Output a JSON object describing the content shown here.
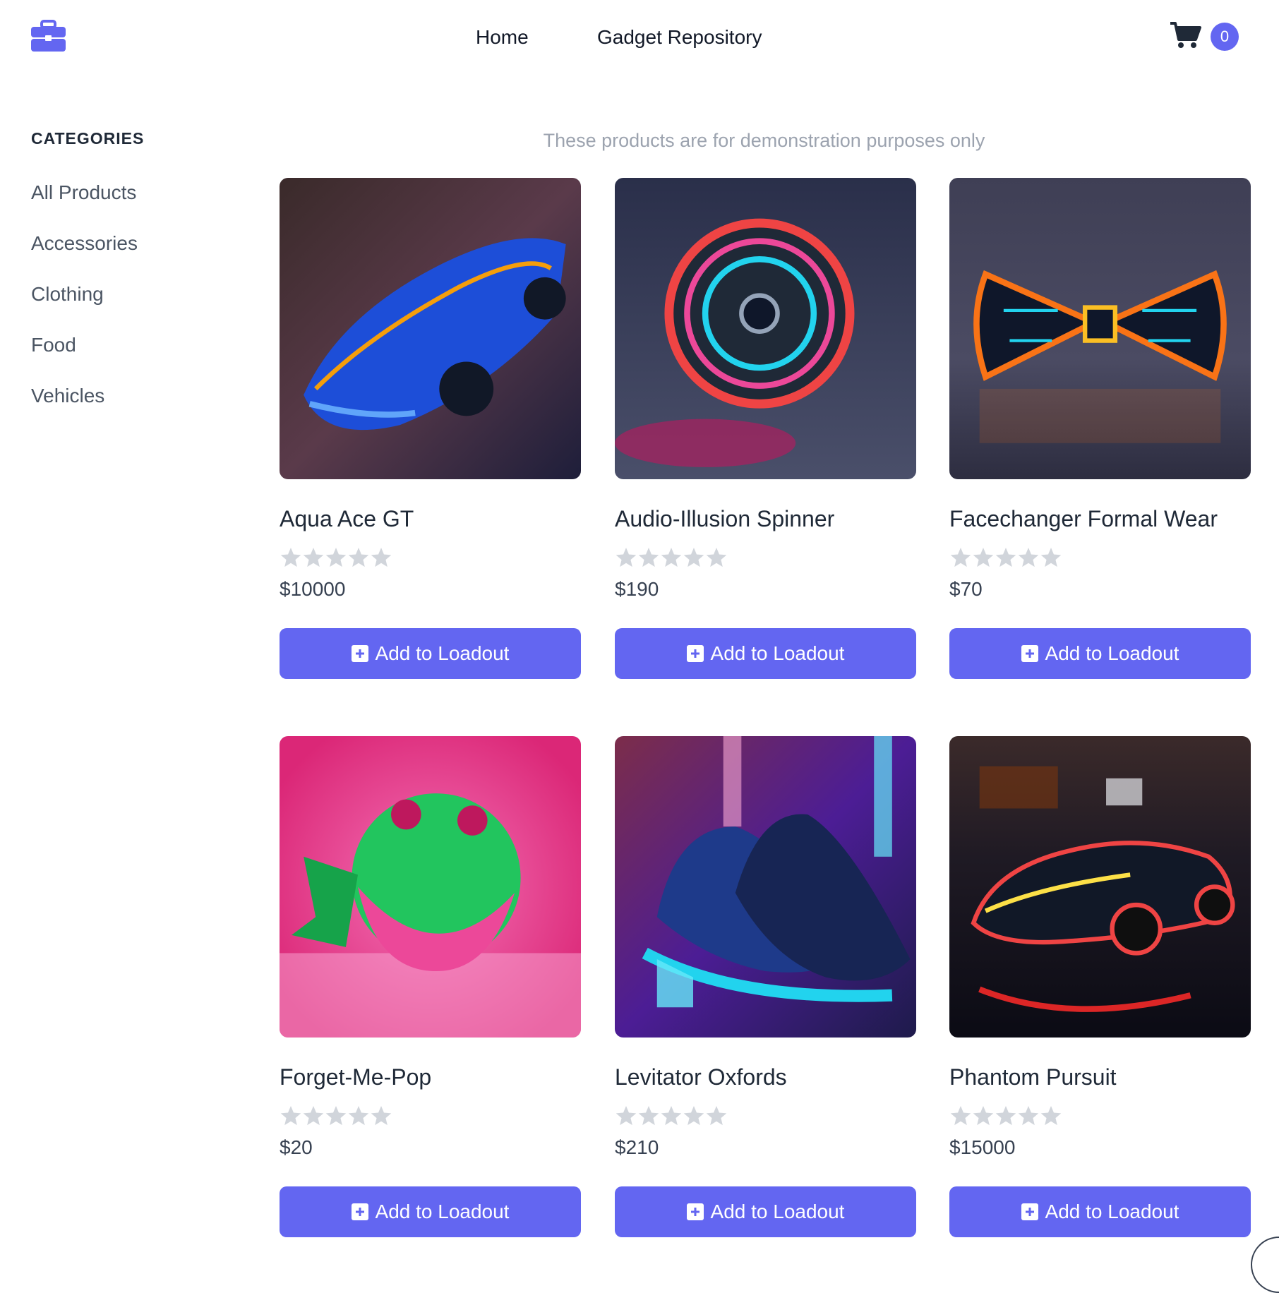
{
  "header": {
    "logo_icon": "briefcase-icon",
    "nav": [
      "Home",
      "Gadget Repository"
    ],
    "cart_icon": "shopping-cart-icon",
    "cart_count": "0"
  },
  "sidebar": {
    "title": "CATEGORIES",
    "items": [
      "All Products",
      "Accessories",
      "Clothing",
      "Food",
      "Vehicles"
    ]
  },
  "main": {
    "notice": "These products are for demonstration purposes only",
    "products": [
      {
        "name": "Aqua Ace GT",
        "price": "$10000",
        "rating": 0,
        "button": "Add to Loadout"
      },
      {
        "name": "Audio-Illusion Spinner",
        "price": "$190",
        "rating": 0,
        "button": "Add to Loadout"
      },
      {
        "name": "Facechanger Formal Wear",
        "price": "$70",
        "rating": 0,
        "button": "Add to Loadout"
      },
      {
        "name": "Forget-Me-Pop",
        "price": "$20",
        "rating": 0,
        "button": "Add to Loadout"
      },
      {
        "name": "Levitator Oxfords",
        "price": "$210",
        "rating": 0,
        "button": "Add to Loadout"
      },
      {
        "name": "Phantom Pursuit",
        "price": "$15000",
        "rating": 0,
        "button": "Add to Loadout"
      }
    ]
  },
  "colors": {
    "accent": "#6366f1",
    "star_empty": "#d1d5db"
  }
}
